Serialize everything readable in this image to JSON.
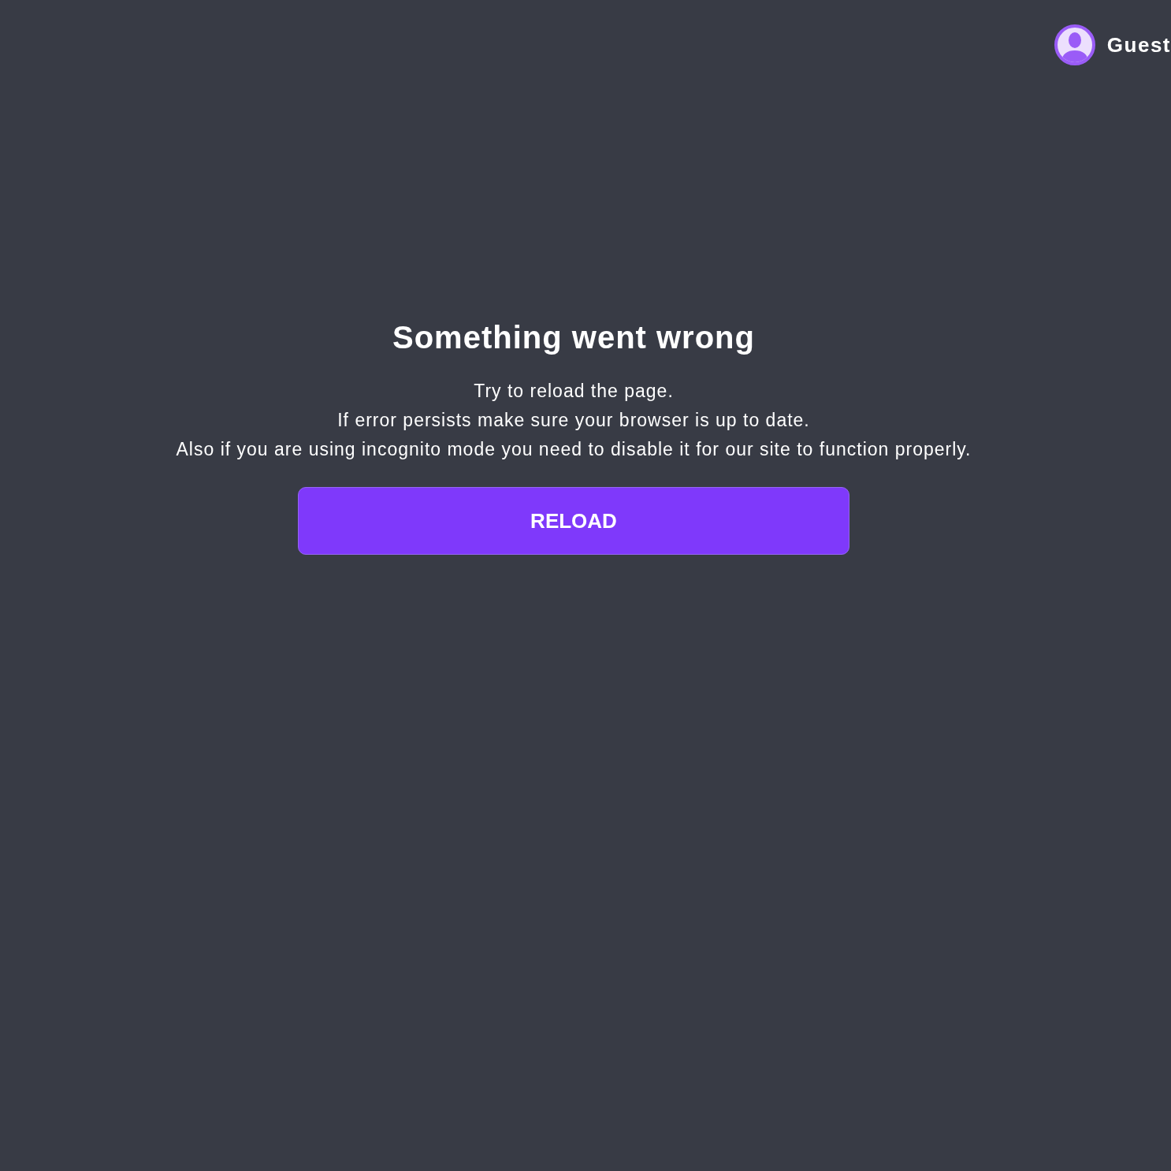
{
  "header": {
    "user": {
      "name": "Guest"
    }
  },
  "error": {
    "title": "Something went wrong",
    "lines": [
      "Try to reload the page.",
      "If error persists make sure your browser is up to date.",
      "Also if you are using incognito mode you need to disable it for our site to function properly."
    ],
    "button": "RELOAD"
  }
}
